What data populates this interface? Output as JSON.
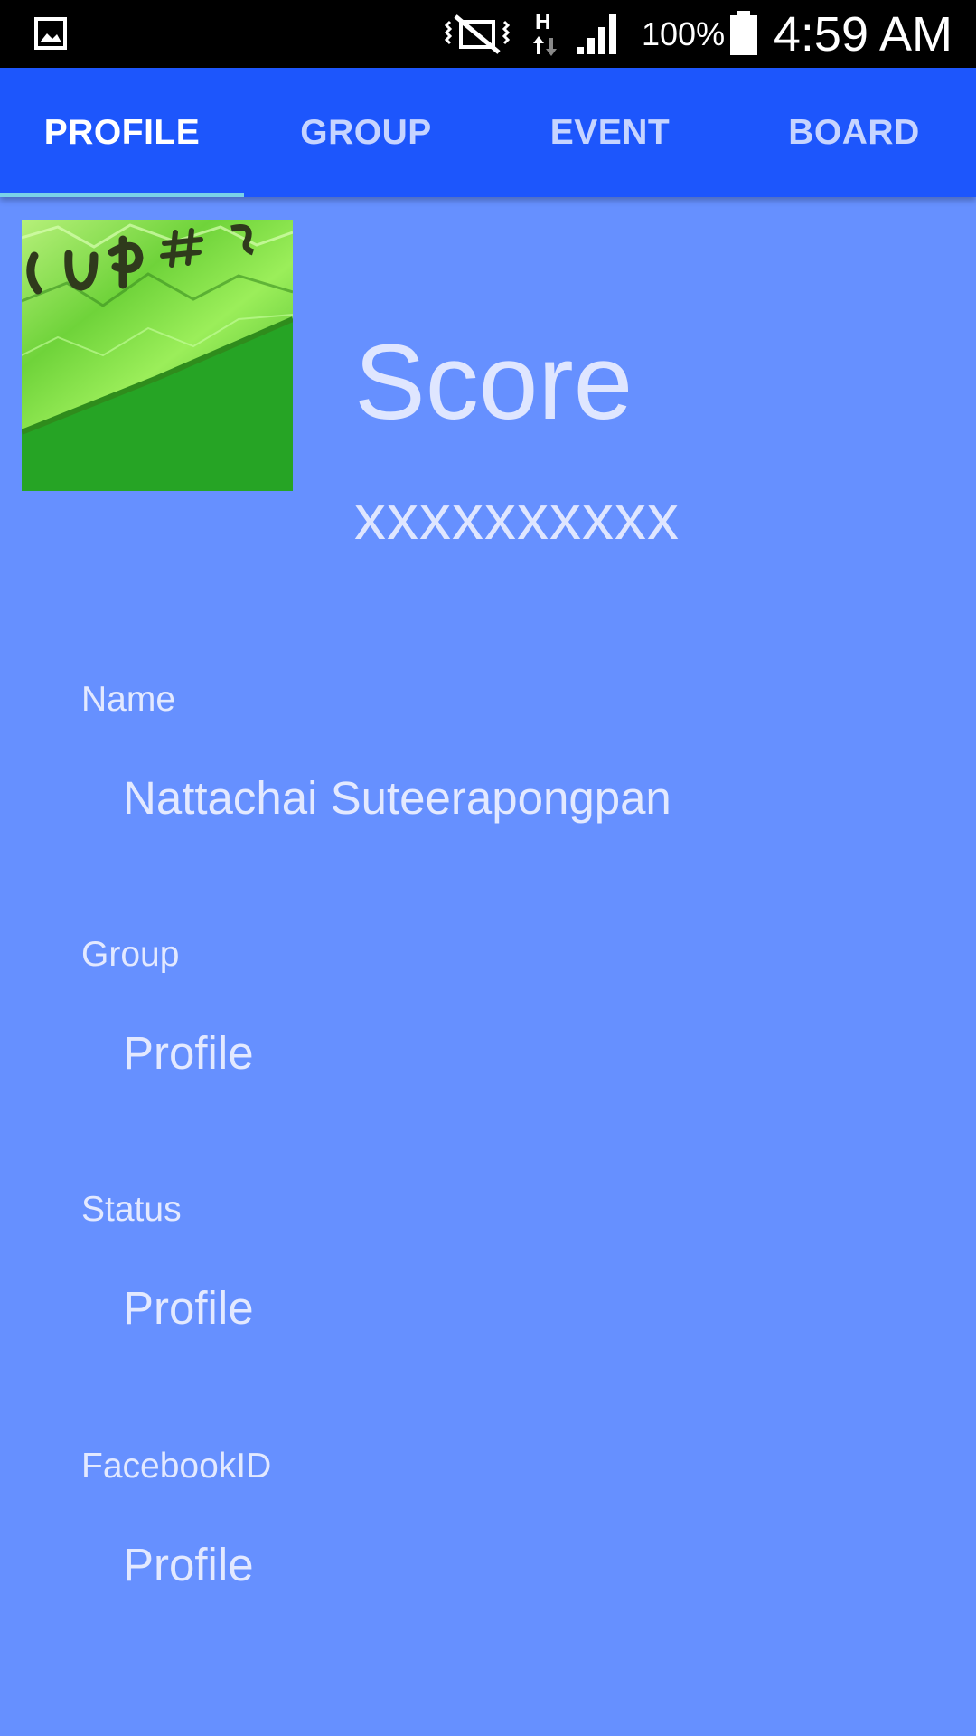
{
  "status_bar": {
    "battery_percent": "100%",
    "time": "4:59 AM",
    "icons": [
      "gallery-icon",
      "mute-icon",
      "network-h-icon",
      "signal-icon",
      "battery-icon"
    ]
  },
  "tabs": [
    {
      "label": "PROFILE",
      "active": true
    },
    {
      "label": "GROUP",
      "active": false
    },
    {
      "label": "EVENT",
      "active": false
    },
    {
      "label": "BOARD",
      "active": false
    }
  ],
  "profile": {
    "score_title": "Score",
    "score_value": "xxxxxxxxxx",
    "fields": [
      {
        "label": "Name",
        "value": "Nattachai Suteerapongpan"
      },
      {
        "label": "Group",
        "value": "Profile"
      },
      {
        "label": "Status",
        "value": "Profile"
      },
      {
        "label": "FacebookID",
        "value": "Profile"
      }
    ]
  },
  "colors": {
    "background": "#6690ff",
    "tab_bar": "#1d56fc",
    "tab_indicator": "#7ad1e8",
    "status_bar": "#000000"
  }
}
